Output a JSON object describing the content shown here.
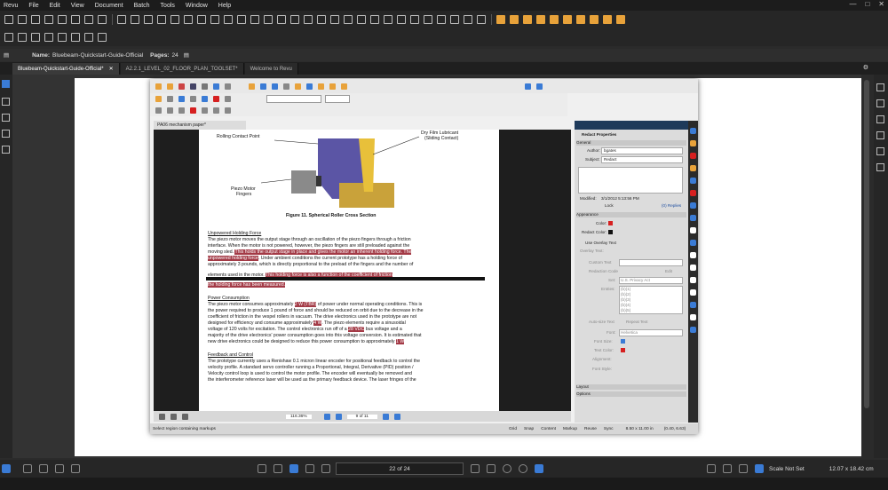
{
  "menu": {
    "app": "Revu",
    "items": [
      "File",
      "Edit",
      "View",
      "Document",
      "Batch",
      "Tools",
      "Window",
      "Help"
    ]
  },
  "namebar": {
    "name_label": "Name:",
    "name_value": "Bluebeam-Quickstart-Guide-Official",
    "pages_label": "Pages:",
    "pages_value": "24"
  },
  "tabs": [
    {
      "label": "Bluebeam-Quickstart-Guide-Official*",
      "active": true
    },
    {
      "label": "A2.2.1_LEVEL_02_FLOOR_PLAN_TOOLSET*",
      "active": false
    },
    {
      "label": "Welcome to Revu",
      "active": false
    }
  ],
  "inner_doc": {
    "tab_label": "PA06 mechanism paper*",
    "figure_labels": {
      "rolling": "Rolling Contact Point",
      "dryfilm1": "Dry Film Lubricant",
      "dryfilm2": "(Sliding Contact)",
      "piezo1": "Piezo Motor",
      "piezo2": "Fingers",
      "caption": "Figure 11.  Spherical Roller Cross Section"
    },
    "sections": {
      "s1_head": "Unpowered Holding Force",
      "s1_l1": "The piezo motor moves the output stage through an oscillation of the piezo fingers through a friction",
      "s1_l2": "interface.  When the motor is not powered, however, the piezo fingers are still preloaded against the",
      "s1_l3a": "moving sled.",
      "s1_l3b": "This holds the output stage in place and gives the motor an inherent holding force. The",
      "s1_l4a": "unpowered holding force",
      "s1_l4b": ".  Under ambient conditions the current prototype has a holding force of",
      "s1_l5": "approximately 3 pounds, which is directly proportional to the preload of the fingers and the number of",
      "s1_l6a": "elements used in the motor.",
      "s1_l6b": "This holding force is also a function of the coefficient of friction",
      "s1_l7": "the holding force has been measured.",
      "s2_head": "Power Consumption",
      "s2_l1a": "The piezo motor consumes approximately",
      "s2_l1b": "2 W (TBR)",
      "s2_l1c": "of power under normal operating conditions.  This is",
      "s2_l2": "the power required to produce 1 pound of force and should be reduced on orbit due to the decrease in the",
      "s2_l3": "coefficient of friction in the vespel rollers in vacuum.  The drive electronics used in the prototype are not",
      "s2_l4a": "designed for efficiency and consume approximately",
      "s2_l4b": "4 W",
      "s2_l4c": ".  The piezo elements require a sinusoidal",
      "s2_l5a": "voltage of 120 volts for excitation.  The control electronics run off of a",
      "s2_l5b": "28 VDC",
      "s2_l5c": "bus voltage and a",
      "s2_l6": "majority of the drive electronics' power consumption goes into this voltage conversion.  It is estimated that",
      "s2_l7a": "new drive electronics could be designed to reduce this power consumption to approximately",
      "s2_l7b": "1 W",
      "s3_head": "Feedback and Control",
      "s3_l1": "The prototype currently uses a Renishaw 0.1 micron linear encoder for positional feedback to control the",
      "s3_l2": "velocity profile.  A standard servo controller running a Proportional, Integral, Derivative (PID) position /",
      "s3_l3": "Velocity control loop is used to control the motor profile.  The encoder will eventually be removed and",
      "s3_l4": "the interferometer reference laser will be used as the primary feedback device.  The laser fringes of the"
    },
    "zoom": "116.36%",
    "page_field": "9 of 11",
    "status_left": "Select region containing markups",
    "status_items": [
      "Grid",
      "Snap",
      "Content",
      "Markup",
      "Reuse",
      "Sync"
    ],
    "status_size": "8.50 x 11.00 in",
    "status_coord": "(0.40, 6.63)"
  },
  "props": {
    "title": "Redact Properties",
    "general": "General",
    "author_label": "Author:",
    "author_value": "bgates",
    "subject_label": "Subject:",
    "subject_value": "Redact",
    "modified_label": "Modified:",
    "modified_value": "3/1/2012 5:13:56 PM",
    "lock_label": "Lock",
    "replies_link": "(0) Replies",
    "appearance": "Appearance",
    "color_label": "Color:",
    "redact_color_label": "Redact Color:",
    "overlay_label": "Use Overlay Text",
    "overlay_text_label": "Overlay Text:",
    "custom_text": "Custom Text",
    "redaction_code": "Redaction Code",
    "set_label": "Set:",
    "set_value": "U.S. Privacy Act",
    "entries_label": "Entries:",
    "entries": [
      "(b)(1)",
      "(b)(2)",
      "(b)(3)",
      "(b)(4)",
      "(b)(5)"
    ],
    "edit_btn": "Edit",
    "autosize": "Auto-size Text",
    "repeat": "Repeat Text",
    "font_label": "Font:",
    "font_value": "Helvetica",
    "fontsize_label": "Font Size:",
    "textcolor_label": "Text Color:",
    "alignment_label": "Alignment:",
    "fontstyle_label": "Font Style:",
    "layout": "Layout",
    "options": "Options"
  },
  "bottom": {
    "page_field": "22 of 24",
    "scale": "Scale Not Set",
    "dims": "12.07 x 18.42 cm"
  },
  "colors": {
    "accent": "#3a7bd5",
    "orange": "#e8a23a",
    "redact": "#a33a46",
    "red": "#d62020"
  }
}
